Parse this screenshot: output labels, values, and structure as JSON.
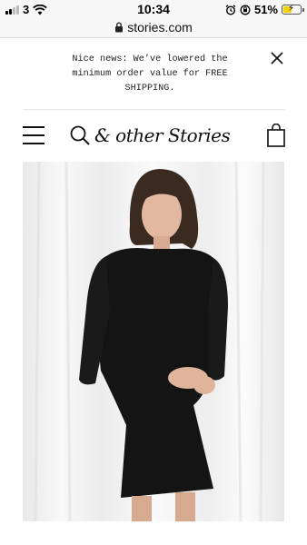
{
  "status_bar": {
    "carrier": "3",
    "time": "10:34",
    "battery_percent": "51%",
    "battery_level": 0.51,
    "icons": [
      "signal-icon",
      "wifi-icon",
      "alarm-icon",
      "orientation-lock-icon",
      "battery-charging-icon"
    ]
  },
  "browser": {
    "url": "stories.com"
  },
  "notice": {
    "text": "Nice news: We’ve lowered the minimum order value for FREE SHIPPING."
  },
  "header": {
    "logo_text": "& other Stories",
    "icons": [
      "menu-icon",
      "search-icon",
      "shopping-bag-icon"
    ]
  },
  "colors": {
    "accent_battery": "#f5d000",
    "text": "#111111",
    "background": "#ffffff"
  }
}
